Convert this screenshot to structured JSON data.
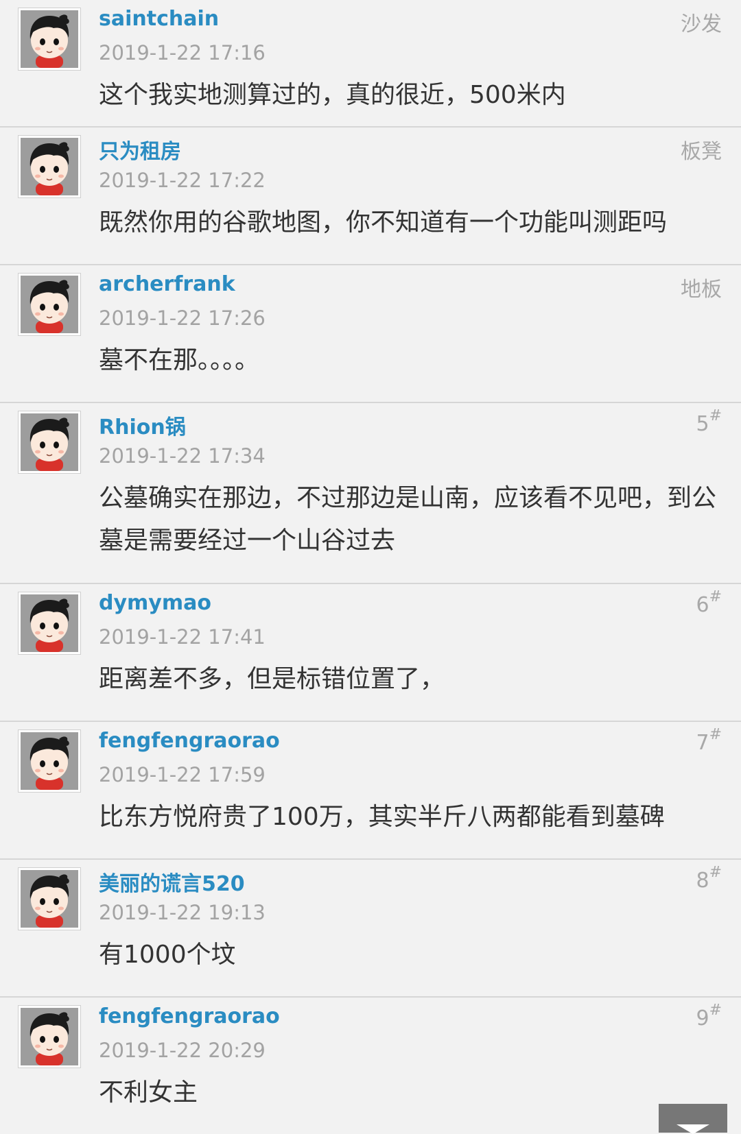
{
  "posts": [
    {
      "user": "saintchain",
      "floor": "沙发",
      "floor_sup": "",
      "time": "2019-1-22 17:16",
      "content": "这个我实地测算过的，真的很近，500米内"
    },
    {
      "user": "只为租房",
      "floor": "板凳",
      "floor_sup": "",
      "time": "2019-1-22 17:22",
      "content": "既然你用的谷歌地图，你不知道有一个功能叫测距吗"
    },
    {
      "user": "archerfrank",
      "floor": "地板",
      "floor_sup": "",
      "time": "2019-1-22 17:26",
      "content": "墓不在那。。。。"
    },
    {
      "user": "Rhion锅",
      "floor": "5",
      "floor_sup": "#",
      "time": "2019-1-22 17:34",
      "content": "公墓确实在那边，不过那边是山南，应该看不见吧，到公墓是需要经过一个山谷过去"
    },
    {
      "user": "dymymao",
      "floor": "6",
      "floor_sup": "#",
      "time": "2019-1-22 17:41",
      "content": "距离差不多，但是标错位置了，"
    },
    {
      "user": "fengfengraorao",
      "floor": "7",
      "floor_sup": "#",
      "time": "2019-1-22 17:59",
      "content": "比东方悦府贵了100万，其实半斤八两都能看到墓碑"
    },
    {
      "user": "美丽的谎言520",
      "floor": "8",
      "floor_sup": "#",
      "time": "2019-1-22 19:13",
      "content": "有1000个坟"
    },
    {
      "user": "fengfengraorao",
      "floor": "9",
      "floor_sup": "#",
      "time": "2019-1-22 20:29",
      "content": "不利女主"
    }
  ],
  "colors": {
    "username": "#2a8cc2",
    "meta": "#a3a3a3",
    "content": "#333333",
    "background": "#f2f2f2",
    "divider": "#d6d6d6"
  },
  "icons": {
    "avatar": "default-boy-avatar-icon",
    "scroll": "chevron-down-icon"
  }
}
